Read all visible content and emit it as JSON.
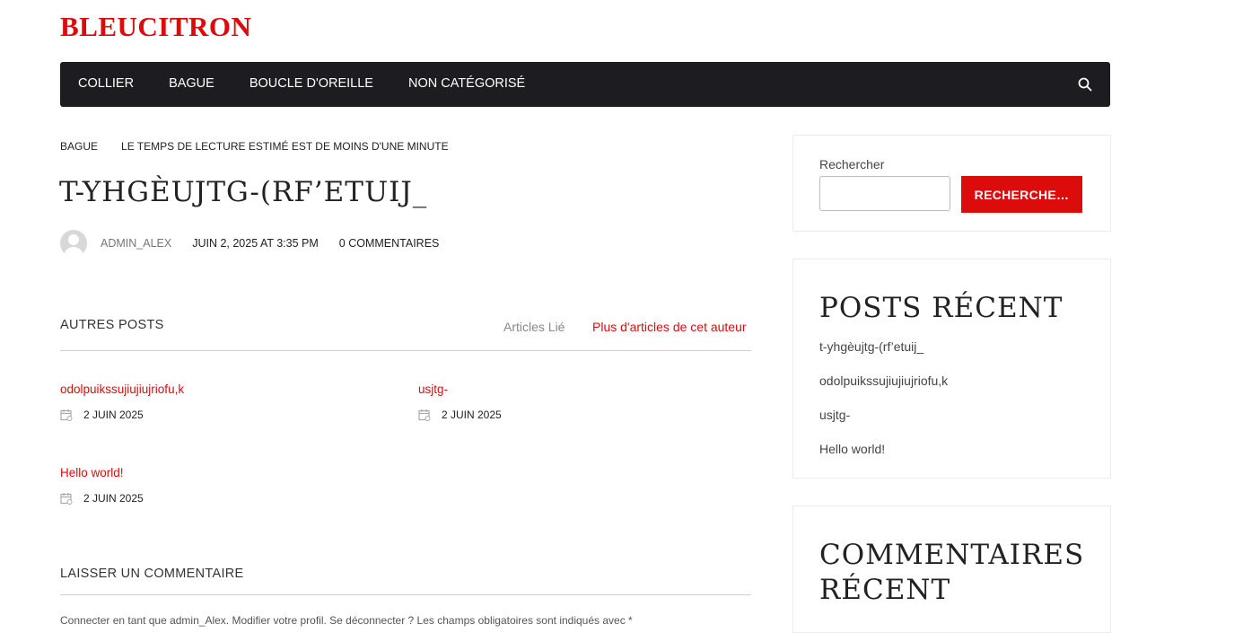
{
  "site": {
    "title": "BLEUCITRON"
  },
  "nav": {
    "items": [
      "COLLIER",
      "BAGUE",
      "BOUCLE D'OREILLE",
      "NON CATÉGORISÉ"
    ],
    "search_icon": "search-icon"
  },
  "post": {
    "category": "BAGUE",
    "reading_time": "LE TEMPS DE LECTURE ESTIMÉ EST DE MOINS D'UNE MINUTE",
    "title": "T-YHGÈUJTG-(RF’ETUIJ_",
    "author": "ADMIN_ALEX",
    "date": "JUIN 2, 2025 AT 3:35 PM",
    "comments": "0 COMMENTAIRES"
  },
  "others": {
    "label": "AUTRES POSTS",
    "tab_related": "Articles Lié",
    "tab_author": "Plus d'articles de cet auteur",
    "posts": [
      {
        "title": "odolpuikssujiujiujriofu,k",
        "date": "2 JUIN 2025"
      },
      {
        "title": "usjtg-",
        "date": "2 JUIN 2025"
      },
      {
        "title": "Hello world!",
        "date": "2 JUIN 2025"
      }
    ]
  },
  "comment_section": {
    "label": "LAISSER UN COMMENTAIRE",
    "note": "Connecter en tant que admin_Alex. Modifier votre profil. Se déconnecter ? Les champs obligatoires sont indiqués avec *"
  },
  "sidebar": {
    "search": {
      "label": "Rechercher",
      "value": "",
      "button": "RECHERCHE…"
    },
    "recent_posts": {
      "title": "POSTS RÉCENT",
      "items": [
        "t-yhgèujtg-(rf’etuij_",
        "odolpuikssujiujiujriofu,k",
        "usjtg-",
        "Hello world!"
      ]
    },
    "recent_comments": {
      "title": "COMMENTAIRES RÉCENT"
    }
  },
  "colors": {
    "accent": "#dd0c0c",
    "nav_bg": "#1d1d21"
  }
}
